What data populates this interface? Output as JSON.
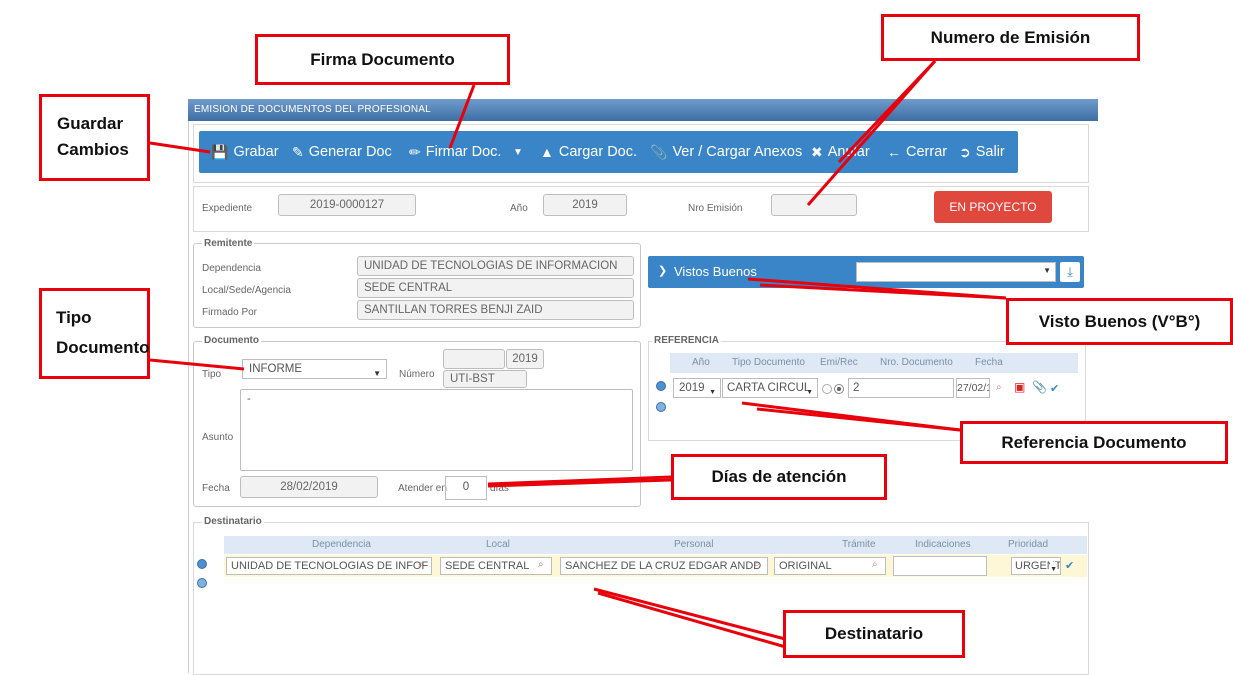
{
  "window": {
    "title": "EMISION DE DOCUMENTOS DEL PROFESIONAL"
  },
  "toolbar": {
    "grabar": "Grabar",
    "generar": "Generar Doc",
    "firmar": "Firmar Doc.",
    "cargar": "Cargar Doc.",
    "anexos": "Ver / Cargar Anexos",
    "anular": "Anular",
    "cerrar": "Cerrar",
    "salir": "Salir"
  },
  "header": {
    "expediente_label": "Expediente",
    "expediente_value": "2019-0000127",
    "anio_label": "Año",
    "anio_value": "2019",
    "nro_emision_label": "Nro Emisión",
    "nro_emision_value": "",
    "estado": "EN PROYECTO"
  },
  "remitente": {
    "legend": "Remitente",
    "dependencia_label": "Dependencia",
    "dependencia_value": "UNIDAD DE TECNOLOGIAS DE INFORMACION",
    "local_label": "Local/Sede/Agencia",
    "local_value": "SEDE CENTRAL",
    "firmado_label": "Firmado Por",
    "firmado_value": "SANTILLAN TORRES BENJI ZAID"
  },
  "vistos_buenos": {
    "label": "Vistos Buenos",
    "select_value": ""
  },
  "documento": {
    "legend": "Documento",
    "tipo_label": "Tipo",
    "tipo_value": "INFORME",
    "numero_label": "Número",
    "numero_value": "",
    "numero_year": "2019",
    "numero_suffix": "UTI-BST",
    "asunto_label": "Asunto",
    "asunto_value": "-",
    "fecha_label": "Fecha",
    "fecha_value": "28/02/2019",
    "atender_label": "Atender en",
    "atender_value": "0",
    "dias_label": "días"
  },
  "referencia": {
    "legend": "REFERENCIA",
    "columns": [
      "Año",
      "Tipo Documento",
      "Emi/Rec",
      "Nro. Documento",
      "Fecha"
    ],
    "row": {
      "anio": "2019",
      "tipo": "CARTA CIRCUL",
      "nro": "2",
      "fecha": "27/02/19"
    }
  },
  "destinatario": {
    "legend": "Destinatario",
    "columns": [
      "Dependencia",
      "Local",
      "Personal",
      "Trámite",
      "Indicaciones",
      "Prioridad"
    ],
    "row": {
      "dependencia": "UNIDAD DE TECNOLOGIAS DE INFOF",
      "local": "SEDE CENTRAL",
      "personal": "SANCHEZ DE LA CRUZ EDGAR ANDD",
      "tramite": "ORIGINAL",
      "indicaciones": "",
      "prioridad": "URGENTI"
    }
  },
  "annotations": {
    "guardar": "Guardar Cambios",
    "firma": "Firma Documento",
    "numero": "Numero de Emisión",
    "tipo": "Tipo Documento",
    "visto": "Visto Buenos (V°B°)",
    "referencia": "Referencia Documento",
    "dias": "Días de atención",
    "destinatario": "Destinatario"
  },
  "colors": {
    "toolbar": "#3a85c8",
    "callout_border": "#e8000b",
    "status": "#e0473d"
  }
}
